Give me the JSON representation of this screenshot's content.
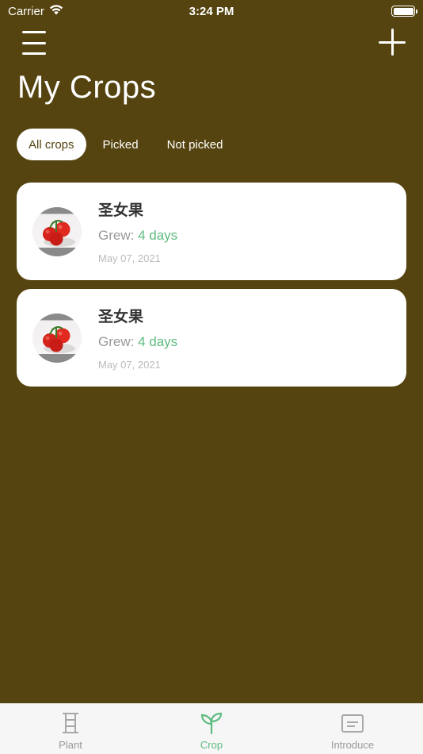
{
  "status_bar": {
    "carrier": "Carrier",
    "time": "3:24 PM"
  },
  "header": {
    "title": "My Crops"
  },
  "filter_tabs": [
    {
      "label": "All crops",
      "active": true
    },
    {
      "label": "Picked",
      "active": false
    },
    {
      "label": "Not picked",
      "active": false
    }
  ],
  "crops": [
    {
      "name": "圣女果",
      "grew_label": "Grew:",
      "grew_value": "4 days",
      "date": "May 07, 2021",
      "icon": "tomato-icon"
    },
    {
      "name": "圣女果",
      "grew_label": "Grew:",
      "grew_value": "4 days",
      "date": "May 07, 2021",
      "icon": "tomato-icon"
    }
  ],
  "tab_bar": {
    "items": [
      {
        "label": "Plant",
        "icon": "greenhouse-icon",
        "active": false
      },
      {
        "label": "Crop",
        "icon": "sprout-icon",
        "active": true
      },
      {
        "label": "Introduce",
        "icon": "document-icon",
        "active": false
      }
    ]
  },
  "colors": {
    "background": "#554410",
    "accent_green": "#5dbb7f",
    "card": "#ffffff",
    "tab_inactive": "#999999"
  }
}
